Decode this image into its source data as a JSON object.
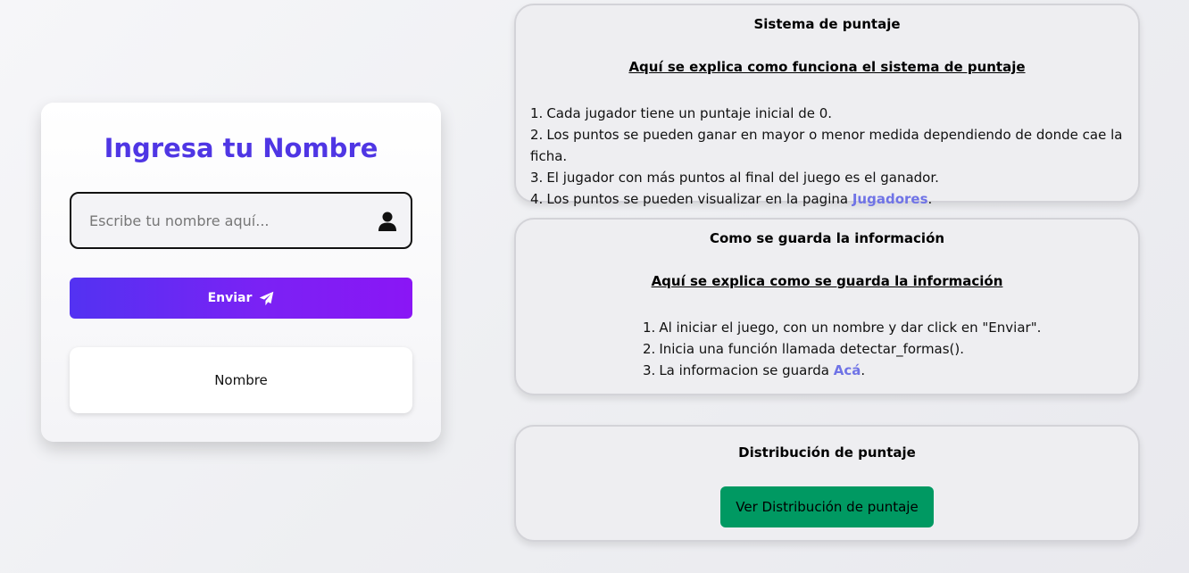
{
  "login": {
    "title": "Ingresa tu Nombre",
    "name_placeholder": "Escribe tu nombre aquí...",
    "name_value": "",
    "send_label": "Enviar",
    "send_icon": "paper-plane-icon",
    "user_icon": "user-icon",
    "name_display": "Nombre",
    "accent_color": "#4f36e4"
  },
  "scoring": {
    "heading": "Sistema de puntaje",
    "subheading": "Aquí se explica como funciona el sistema de puntaje",
    "items": [
      {
        "num": "1.",
        "text": "Cada jugador tiene un puntaje inicial de 0."
      },
      {
        "num": "2.",
        "text": "Los puntos se pueden ganar en mayor o menor medida dependiendo de donde cae la ficha."
      },
      {
        "num": "3.",
        "text": "El jugador con más puntos al final del juego es el ganador."
      },
      {
        "num": "4.",
        "text": "Los puntos se pueden visualizar en la pagina ",
        "link": "Jugadores",
        "after": "."
      }
    ]
  },
  "storage": {
    "heading": "Como se guarda la información",
    "subheading": "Aquí se explica como se guarda la información",
    "items": [
      {
        "num": "1.",
        "text": "Al iniciar el juego, con un nombre y dar click en \"Enviar\"."
      },
      {
        "num": "2.",
        "text": "Inicia una función llamada detectar_formas()."
      },
      {
        "num": "3.",
        "text": "La informacion se guarda ",
        "link": "Acá",
        "after": "."
      }
    ]
  },
  "distribution": {
    "heading": "Distribución de puntaje",
    "button_label": "Ver Distribución de puntaje",
    "button_color": "#009962"
  },
  "colors": {
    "link": "#6f73e6",
    "button_gradient_start": "#5332f2",
    "button_gradient_end": "#8a16f5"
  }
}
